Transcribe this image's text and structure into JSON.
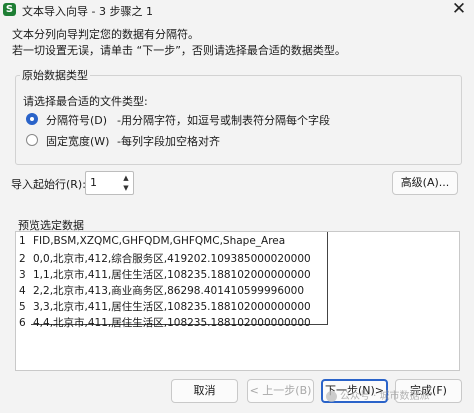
{
  "window": {
    "icon_letter": "S",
    "title": "文本导入向导 - 3 步骤之 1",
    "close_glyph": "✕"
  },
  "intro": {
    "line1": "文本分列向导判定您的数据有分隔符。",
    "line2": "若一切设置无误，请单击 “下一步”，否则请选择最合适的数据类型。"
  },
  "original_type": {
    "legend": "原始数据类型",
    "prompt": "请选择最合适的文件类型:",
    "options": [
      {
        "label": "分隔符号(D)",
        "description": "-用分隔字符，如逗号或制表符分隔每个字段",
        "checked": true
      },
      {
        "label": "固定宽度(W)",
        "description": "-每列字段加空格对齐",
        "checked": false
      }
    ]
  },
  "start_row": {
    "label": "导入起始行(R):",
    "value": "1",
    "up_glyph": "▲",
    "down_glyph": "▼"
  },
  "advanced_button": "高级(A)...",
  "preview": {
    "label": "预览选定数据",
    "rows": [
      {
        "num": "1",
        "text": "FID,BSM,XZQMC,GHFQDM,GHFQMC,Shape_Area"
      },
      {
        "num": "2",
        "text": "0,0,北京市,412,综合服务区,419202.109385000020000"
      },
      {
        "num": "3",
        "text": "1,1,北京市,411,居住生活区,108235.188102000000000"
      },
      {
        "num": "4",
        "text": "2,2,北京市,413,商业商务区,86298.401410599996000"
      },
      {
        "num": "5",
        "text": "3,3,北京市,411,居住生活区,108235.188102000000000"
      },
      {
        "num": "6",
        "text": "4,4,北京市,411,居住生活区,108235.188102000000000"
      }
    ]
  },
  "buttons": {
    "cancel": "取消",
    "back": "< 上一步(B)",
    "next": "下一步(N)>",
    "finish": "完成(F)"
  },
  "watermark": "公众号 · 城市数据派",
  "colors": {
    "accent": "#2a63c9",
    "app_icon": "#1e7e34"
  }
}
